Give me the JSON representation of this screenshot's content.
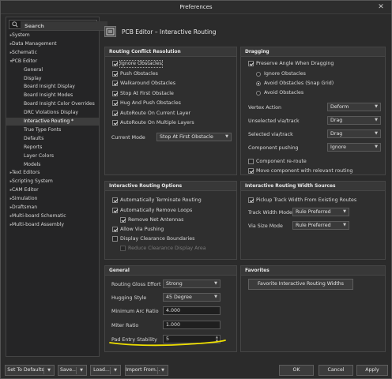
{
  "window": {
    "title": "Preferences",
    "close": "✕"
  },
  "search": {
    "placeholder": "Search"
  },
  "tree": [
    {
      "label": "System",
      "caret": "▸"
    },
    {
      "label": "Data Management",
      "caret": "▸"
    },
    {
      "label": "Schematic",
      "caret": "▸"
    },
    {
      "label": "PCB Editor",
      "caret": "▾"
    },
    {
      "label": "General",
      "caret": ""
    },
    {
      "label": "Display",
      "caret": ""
    },
    {
      "label": "Board Insight Display",
      "caret": ""
    },
    {
      "label": "Board Insight Modes",
      "caret": ""
    },
    {
      "label": "Board Insight Color Overrides",
      "caret": ""
    },
    {
      "label": "DRC Violations Display",
      "caret": ""
    },
    {
      "label": "Interactive Routing *",
      "caret": ""
    },
    {
      "label": "True Type Fonts",
      "caret": ""
    },
    {
      "label": "Defaults",
      "caret": ""
    },
    {
      "label": "Reports",
      "caret": ""
    },
    {
      "label": "Layer Colors",
      "caret": ""
    },
    {
      "label": "Models",
      "caret": ""
    },
    {
      "label": "Text Editors",
      "caret": "▸"
    },
    {
      "label": "Scripting System",
      "caret": "▸"
    },
    {
      "label": "CAM Editor",
      "caret": "▸"
    },
    {
      "label": "Simulation",
      "caret": "▸"
    },
    {
      "label": "Draftsman",
      "caret": "▸"
    },
    {
      "label": "Multi-board Schematic",
      "caret": "▸"
    },
    {
      "label": "Multi-board Assembly",
      "caret": "▸"
    }
  ],
  "header": {
    "title": "PCB Editor – Interactive Routing"
  },
  "conflict": {
    "title": "Routing Conflict Resolution",
    "options": [
      {
        "label": "Ignore Obstacles",
        "checked": true
      },
      {
        "label": "Push Obstacles",
        "checked": true
      },
      {
        "label": "Walkaround Obstacles",
        "checked": true
      },
      {
        "label": "Stop At First Obstacle",
        "checked": true
      },
      {
        "label": "Hug And Push Obstacles",
        "checked": true
      },
      {
        "label": "AutoRoute On Current Layer",
        "checked": true
      },
      {
        "label": "AutoRoute On Multiple Layers",
        "checked": true
      }
    ],
    "current_mode_label": "Current Mode",
    "current_mode_value": "Stop At First Obstacle"
  },
  "dragging": {
    "title": "Dragging",
    "preserve": "Preserve Angle When Dragging",
    "radios": [
      "Ignore Obstacles",
      "Avoid Obstacles (Snap Grid)",
      "Avoid Obstacles"
    ],
    "vertex_label": "Vertex Action",
    "vertex_value": "Deform",
    "unsel_label": "Unselected via/track",
    "unsel_value": "Drag",
    "sel_label": "Selected via/track",
    "sel_value": "Drag",
    "push_label": "Component pushing",
    "push_value": "Ignore",
    "reroute": "Component re-route",
    "move": "Move component with relevant routing"
  },
  "options": {
    "title": "Interactive Routing Options",
    "auto_terminate": "Automatically Terminate Routing",
    "auto_remove": "Automatically Remove Loops",
    "remove_antennas": "Remove Net Antennas",
    "allow_via": "Allow Via Pushing",
    "display_clear": "Display Clearance Boundaries",
    "reduce_clear": "Reduce Clearance Display Area"
  },
  "width": {
    "title": "Interactive Routing Width Sources",
    "pickup": "Pickup Track Width From Existing Routes",
    "track_label": "Track Width Mode",
    "track_value": "Rule Preferred",
    "via_label": "Via Size Mode",
    "via_value": "Rule Preferred"
  },
  "general": {
    "title": "General",
    "gloss_label": "Routing Gloss Effort",
    "gloss_value": "Strong",
    "hug_label": "Hugging Style",
    "hug_value": "45 Degree",
    "arc_label": "Minimum Arc Ratio",
    "arc_value": "4.000",
    "miter_label": "Miter Ratio",
    "miter_value": "1.000",
    "pad_label": "Pad Entry Stability",
    "pad_value": "5"
  },
  "favorites": {
    "title": "Favorites",
    "button": "Favorite Interactive Routing Widths"
  },
  "footer": {
    "defaults": "Set To Defaults",
    "save": "Save...",
    "load": "Load...",
    "import": "Import From...",
    "ok": "OK",
    "cancel": "Cancel",
    "apply": "Apply"
  },
  "colors": {
    "highlight": "#f0e000"
  }
}
